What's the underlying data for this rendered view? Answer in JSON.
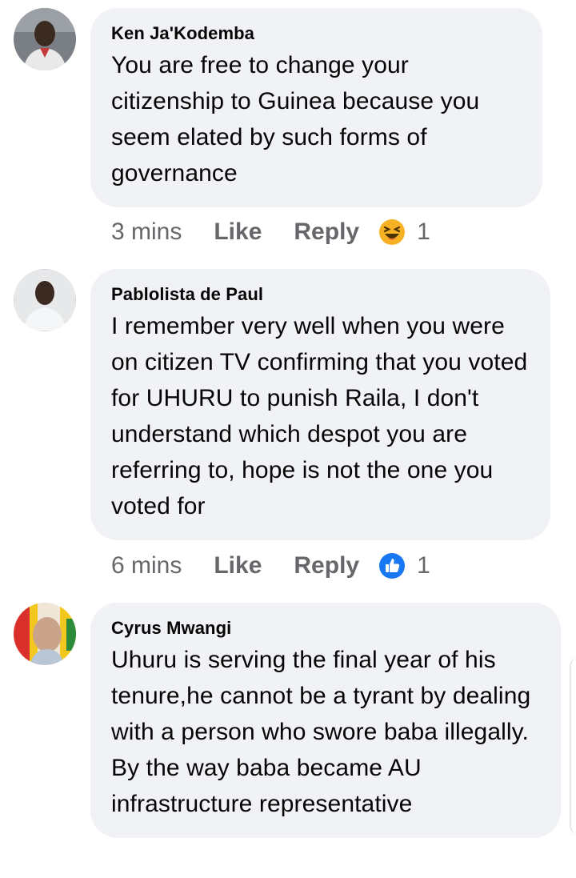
{
  "comments": [
    {
      "author": "Ken Ja'Kodemba",
      "text": "You are free to change your citizenship to Guinea because you seem elated by such forms of governance",
      "time": "3 mins",
      "like_label": "Like",
      "reply_label": "Reply",
      "reaction_icon": "haha-emoji-icon",
      "reaction_count": "1"
    },
    {
      "author": "Pablolista de Paul",
      "text": "I remember very well when you were on citizen TV confirming that you voted for UHURU to punish Raila, I don't understand which despot you are referring to, hope is not the one you voted for",
      "time": "6 mins",
      "like_label": "Like",
      "reply_label": "Reply",
      "reaction_icon": "like-thumb-icon",
      "reaction_count": "1"
    },
    {
      "author": "Cyrus Mwangi",
      "text": "Uhuru is serving the final year of his tenure,he cannot be a tyrant by dealing with a person who swore baba illegally. By the way baba became AU infrastructure representative"
    }
  ],
  "colors": {
    "bubble": "#f0f2f5",
    "meta_text": "#65676b",
    "like_blue": "#1877f2",
    "haha_yellow": "#f7b125"
  }
}
